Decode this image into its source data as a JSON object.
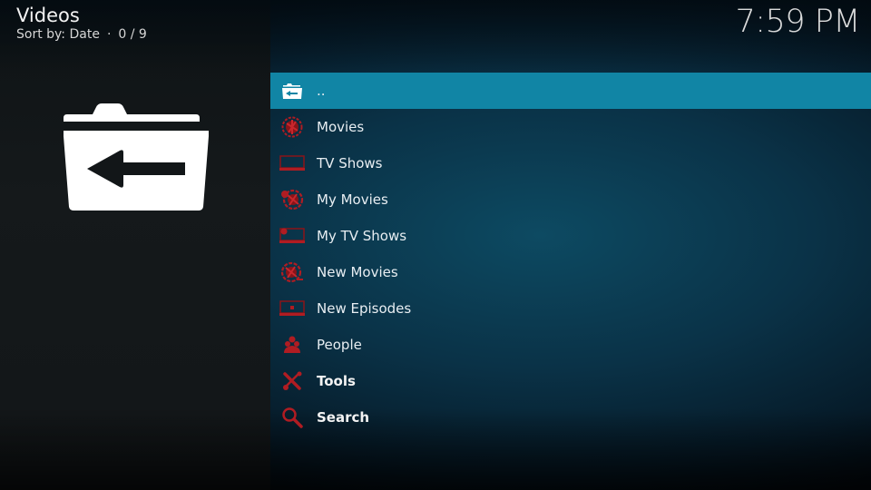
{
  "header": {
    "title": "Videos",
    "sort_label": "Sort by: Date",
    "separator": "·",
    "position": "0 / 9"
  },
  "clock": "7:59 PM",
  "colors": {
    "focus": "#1185a5",
    "icon_red": "#b01c22"
  },
  "list": {
    "items": [
      {
        "label": "..",
        "icon": "folder-back-icon",
        "focused": true
      },
      {
        "label": "Movies",
        "icon": "film-reel-icon"
      },
      {
        "label": "TV Shows",
        "icon": "tv-icon"
      },
      {
        "label": "My Movies",
        "icon": "film-reel-icon"
      },
      {
        "label": "My TV Shows",
        "icon": "tv-icon"
      },
      {
        "label": "New Movies",
        "icon": "film-reel-icon"
      },
      {
        "label": "New Episodes",
        "icon": "tv-icon"
      },
      {
        "label": "People",
        "icon": "people-icon"
      },
      {
        "label": "Tools",
        "icon": "tools-icon"
      },
      {
        "label": "Search",
        "icon": "search-icon"
      }
    ]
  }
}
